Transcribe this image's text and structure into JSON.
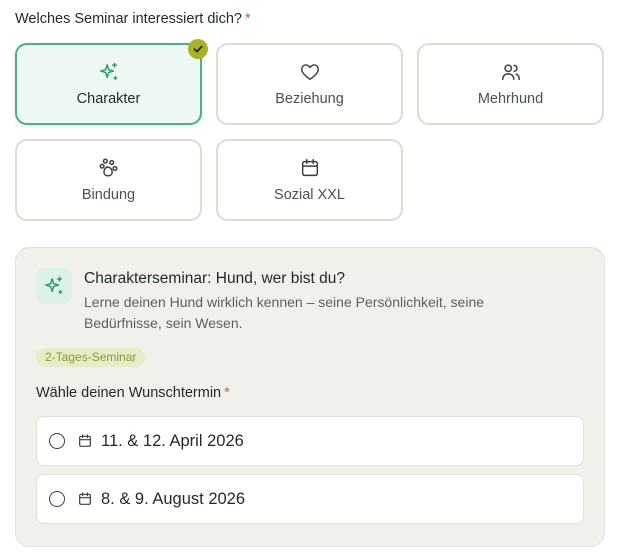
{
  "question": {
    "label": "Welches Seminar interessiert dich?",
    "required_mark": "*"
  },
  "options": [
    {
      "label": "Charakter",
      "icon": "sparkles-icon",
      "selected": true
    },
    {
      "label": "Beziehung",
      "icon": "heart-icon",
      "selected": false
    },
    {
      "label": "Mehrhund",
      "icon": "users-icon",
      "selected": false
    },
    {
      "label": "Bindung",
      "icon": "paw-icon",
      "selected": false
    },
    {
      "label": "Sozial XXL",
      "icon": "calendar-icon",
      "selected": false
    }
  ],
  "detail": {
    "icon": "sparkles-icon",
    "title": "Charakterseminar: Hund, wer bist du?",
    "description": "Lerne deinen Hund wirklich kennen – seine Persönlichkeit, seine Bedürfnisse, sein Wesen.",
    "badge": "2-Tages-Seminar",
    "date_label": "Wähle deinen Wunschtermin",
    "date_required_mark": "*",
    "dates": [
      {
        "label": "11. & 12. April 2026",
        "selected": false
      },
      {
        "label": "8. & 9. August 2026",
        "selected": false
      }
    ]
  },
  "colors": {
    "accent_green": "#4caf85",
    "check_olive": "#a7b327",
    "selected_bg": "#edf8f2",
    "panel_bg": "#f1f1eb",
    "badge_bg": "#e8ebca",
    "badge_text": "#8f9a2a",
    "required": "#d9534f"
  }
}
